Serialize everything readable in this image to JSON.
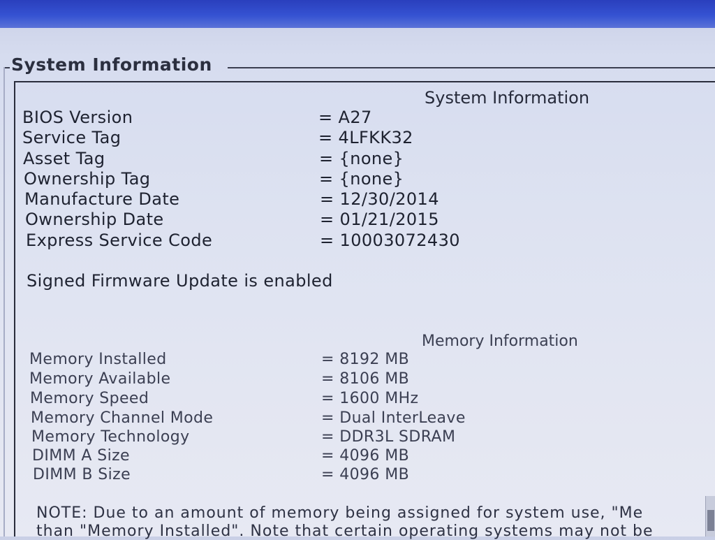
{
  "window": {
    "group_title": "System Information"
  },
  "system_info": {
    "heading": "System Information",
    "rows": [
      {
        "label": "BIOS Version",
        "value": "= A27"
      },
      {
        "label": "Service Tag",
        "value": "= 4LFKK32"
      },
      {
        "label": "Asset Tag",
        "value": "= {none}"
      },
      {
        "label": "Ownership Tag",
        "value": "= {none}"
      },
      {
        "label": "Manufacture Date",
        "value": "= 12/30/2014"
      },
      {
        "label": "Ownership Date",
        "value": "= 01/21/2015"
      },
      {
        "label": "Express Service Code",
        "value": "= 10003072430"
      }
    ],
    "firmware_notice": "Signed Firmware Update is enabled"
  },
  "memory_info": {
    "heading": "Memory Information",
    "rows": [
      {
        "label": "Memory Installed",
        "value": "= 8192 MB"
      },
      {
        "label": "Memory Available",
        "value": "= 8106 MB"
      },
      {
        "label": "Memory Speed",
        "value": "= 1600 MHz"
      },
      {
        "label": "Memory Channel Mode",
        "value": "= Dual InterLeave"
      },
      {
        "label": "Memory Technology",
        "value": "= DDR3L SDRAM"
      },
      {
        "label": "DIMM A Size",
        "value": "= 4096 MB"
      },
      {
        "label": "DIMM B Size",
        "value": "= 4096 MB"
      }
    ],
    "note_line_1": "NOTE: Due to an amount of memory being assigned for system use, \"Me",
    "note_line_2": "than \"Memory Installed\". Note that certain operating systems may not be"
  },
  "colors": {
    "title_bar": "#2a3fbd",
    "background": "#dde2f1",
    "text": "#1e2230"
  }
}
